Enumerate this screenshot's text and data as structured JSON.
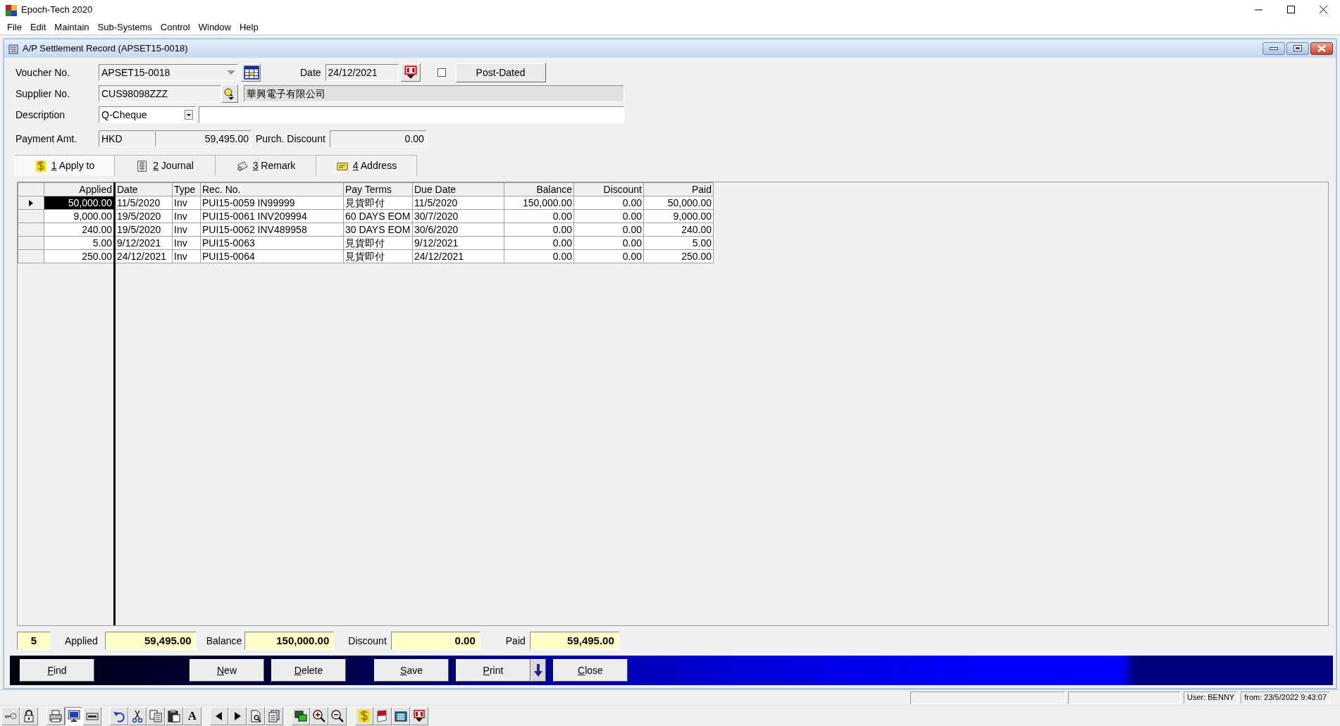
{
  "app": {
    "title": "Epoch-Tech 2020"
  },
  "menu": [
    "File",
    "Edit",
    "Maintain",
    "Sub-Systems",
    "Control",
    "Window",
    "Help"
  ],
  "document": {
    "title": "A/P Settlement Record (APSET15-0018)"
  },
  "form": {
    "voucher_label": "Voucher No.",
    "voucher_no": "APSET15-0018",
    "date_label": "Date",
    "date": "24/12/2021",
    "post_dated": {
      "label": "Post-Dated",
      "checked": false
    },
    "supplier_label": "Supplier No.",
    "supplier_no": "CUS98098ZZZ",
    "supplier_name": "華興電子有限公司",
    "description_label": "Description",
    "description_type": "Q-Cheque",
    "payment_label": "Payment Amt.",
    "currency": "HKD",
    "payment_amount": "59,495.00",
    "discount_label": "Purch. Discount",
    "discount": "0.00"
  },
  "tabs": [
    {
      "label": "1 Apply to",
      "kind": "dollar",
      "selected": true
    },
    {
      "label": "2 Journal",
      "kind": "journal",
      "selected": false
    },
    {
      "label": "3 Remark",
      "kind": "remark",
      "selected": false
    },
    {
      "label": "4 Address",
      "kind": "address",
      "selected": false
    }
  ],
  "table": {
    "columns": [
      "Applied",
      "Date",
      "Type",
      "Rec. No.",
      "Pay Terms",
      "Due Date",
      "Balance",
      "Discount",
      "Paid"
    ],
    "rows": [
      {
        "selected": true,
        "cells": [
          "50,000.00",
          "11/5/2020",
          "Inv",
          "PUI15-0059 IN99999",
          "見貨即付",
          "11/5/2020",
          "150,000.00",
          "0.00",
          "50,000.00"
        ]
      },
      {
        "selected": false,
        "cells": [
          "9,000.00",
          "19/5/2020",
          "Inv",
          "PUI15-0061 INV209994",
          "60 DAYS EOM",
          "30/7/2020",
          "0.00",
          "0.00",
          "9,000.00"
        ]
      },
      {
        "selected": false,
        "cells": [
          "240.00",
          "19/5/2020",
          "Inv",
          "PUI15-0062 INV489958",
          "30 DAYS EOM",
          "30/6/2020",
          "0.00",
          "0.00",
          "240.00"
        ]
      },
      {
        "selected": false,
        "cells": [
          "5.00",
          "9/12/2021",
          "Inv",
          "PUI15-0063",
          "見貨即付",
          "9/12/2021",
          "0.00",
          "0.00",
          "5.00"
        ]
      },
      {
        "selected": false,
        "cells": [
          "250.00",
          "24/12/2021",
          "Inv",
          "PUI15-0064",
          "見貨即付",
          "24/12/2021",
          "0.00",
          "0.00",
          "250.00"
        ]
      }
    ]
  },
  "totals": {
    "count": "5",
    "applied_label": "Applied",
    "applied": "59,495.00",
    "balance_label": "Balance",
    "balance": "150,000.00",
    "discount_label": "Discount",
    "discount": "0.00",
    "paid_label": "Paid",
    "paid": "59,495.00"
  },
  "buttons": [
    {
      "label": "Find",
      "kind": "plain"
    },
    {
      "label": "New",
      "kind": "plain"
    },
    {
      "label": "Delete",
      "kind": "plain"
    },
    {
      "label": "Save",
      "kind": "plain"
    },
    {
      "label": "Print",
      "kind": "split"
    },
    {
      "label": "Close",
      "kind": "plain"
    }
  ],
  "status_bar": [
    "User: BENNY",
    "from: 23/5/2022 9:43:07"
  ],
  "toolbar": [
    [
      {
        "kind": "key",
        "on": false
      },
      {
        "kind": "lock",
        "on": false
      }
    ],
    [
      {
        "kind": "printer",
        "on": false
      },
      {
        "kind": "monitor",
        "on": true
      },
      {
        "kind": "bar",
        "on": false
      }
    ],
    [
      {
        "kind": "undo",
        "on": false
      },
      {
        "kind": "scissors",
        "on": false
      },
      {
        "kind": "copy",
        "on": false
      },
      {
        "kind": "paste",
        "on": false
      },
      {
        "kind": "font",
        "text": "A",
        "on": false
      }
    ],
    [
      {
        "kind": "left",
        "on": false
      },
      {
        "kind": "right",
        "on": false
      },
      {
        "kind": "preview",
        "on": false
      },
      {
        "kind": "docs",
        "on": false
      }
    ],
    [
      {
        "kind": "windows",
        "on": false
      },
      {
        "kind": "zoomin",
        "on": false
      },
      {
        "kind": "zoomout",
        "on": false
      }
    ],
    [
      {
        "kind": "dollar",
        "on": false
      },
      {
        "kind": "book",
        "on": false
      },
      {
        "kind": "calculator",
        "on": false
      },
      {
        "kind": "calendar",
        "on": false
      }
    ]
  ]
}
